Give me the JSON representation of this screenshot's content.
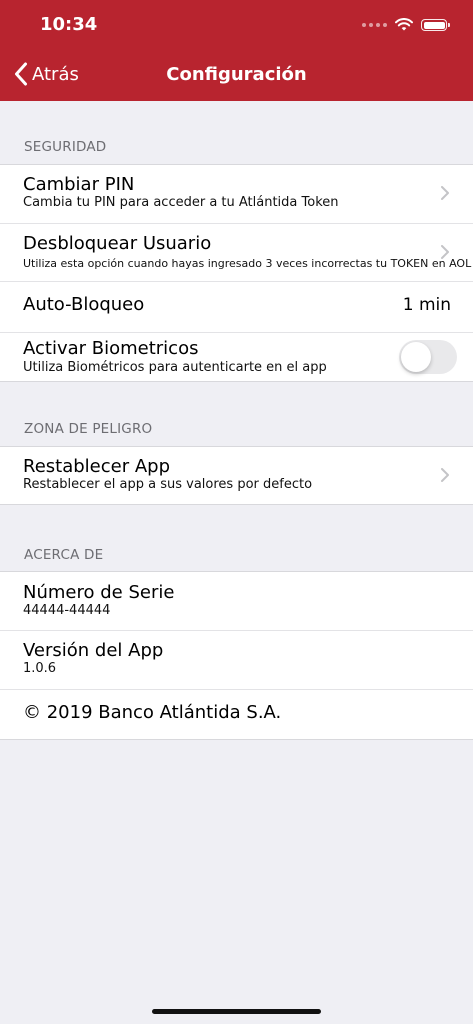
{
  "status_bar": {
    "time": "10:34"
  },
  "nav": {
    "back_label": "Atrás",
    "title": "Configuración"
  },
  "seguridad": {
    "header": "SEGURIDAD",
    "cambiar_pin": {
      "title": "Cambiar PIN",
      "subtitle": "Cambia tu PIN para acceder a tu Atlántida Token"
    },
    "desbloquear": {
      "title": "Desbloquear Usuario",
      "subtitle": "Utiliza esta opción cuando hayas ingresado 3 veces incorrectas tu TOKEN en AOL"
    },
    "auto_bloqueo": {
      "title": "Auto-Bloqueo",
      "value": "1 min"
    },
    "biometricos": {
      "title": "Activar Biometricos",
      "subtitle": "Utiliza Biométricos para autenticarte en el app",
      "enabled": false
    }
  },
  "peligro": {
    "header": "ZONA DE PELIGRO",
    "restablecer": {
      "title": "Restablecer App",
      "subtitle": "Restablecer el app a sus valores por defecto"
    }
  },
  "acerca": {
    "header": "ACERCA DE",
    "serie": {
      "title": "Número de Serie",
      "value": "44444-44444"
    },
    "version": {
      "title": "Versión del App",
      "value": "1.0.6"
    },
    "copyright": "© 2019 Banco Atlántida S.A."
  },
  "colors": {
    "brand_red": "#b8242f",
    "background": "#efeff4",
    "section_text": "#6d6d72",
    "chevron": "#c4c4c7"
  }
}
